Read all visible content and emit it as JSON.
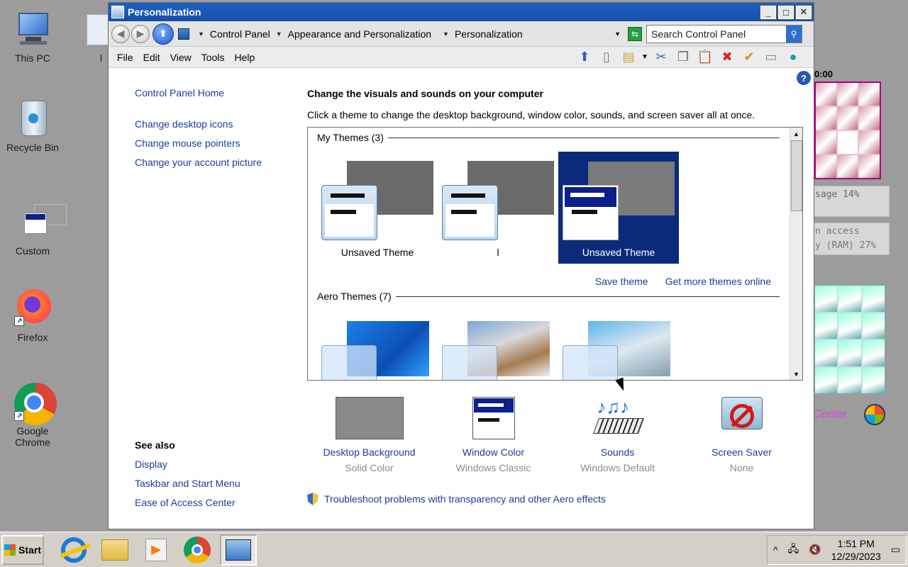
{
  "desktop": {
    "icons": [
      {
        "label": "This PC"
      },
      {
        "label": "l"
      },
      {
        "label": "Recycle Bin"
      },
      {
        "label": "Custom"
      },
      {
        "label": "Firefox"
      },
      {
        "label": "Google Chrome"
      }
    ],
    "gadgets": {
      "time": "0:00",
      "meter_line1": "sage 14%",
      "meter_line2": "n access",
      "meter_line3": "y (RAM) 27%",
      "meter_small": "27%",
      "center_text": "Center"
    }
  },
  "window": {
    "title": "Personalization",
    "buttons": {
      "minimize": "_",
      "maximize": "□",
      "close": "✕"
    }
  },
  "address": {
    "crumbs": [
      "Control Panel",
      "Appearance and Personalization",
      "Personalization"
    ],
    "search_placeholder": "Search Control Panel"
  },
  "menu": [
    "File",
    "Edit",
    "View",
    "Tools",
    "Help"
  ],
  "left_pane": {
    "home": "Control Panel Home",
    "links": [
      "Change desktop icons",
      "Change mouse pointers",
      "Change your account picture"
    ],
    "see_also_title": "See also",
    "see_also": [
      "Display",
      "Taskbar and Start Menu",
      "Ease of Access Center"
    ]
  },
  "main": {
    "heading": "Change the visuals and sounds on your computer",
    "subtitle": "Click a theme to change the desktop background, window color, sounds, and screen saver all at once.",
    "my_themes_label": "My Themes (3)",
    "my_themes": [
      {
        "name": "Unsaved Theme",
        "selected": false
      },
      {
        "name": "l",
        "selected": false
      },
      {
        "name": "Unsaved Theme",
        "selected": true
      }
    ],
    "save_theme": "Save theme",
    "get_more": "Get more themes online",
    "aero_themes_label": "Aero Themes (7)"
  },
  "settings": [
    {
      "label": "Desktop Background",
      "value": "Solid Color"
    },
    {
      "label": "Window Color",
      "value": "Windows Classic"
    },
    {
      "label": "Sounds",
      "value": "Windows Default"
    },
    {
      "label": "Screen Saver",
      "value": "None"
    }
  ],
  "troubleshoot": "Troubleshoot problems with transparency and other Aero effects",
  "help_icon": "?",
  "taskbar": {
    "start": "Start",
    "time": "1:51 PM",
    "date": "12/29/2023",
    "tray_expand": "^"
  }
}
